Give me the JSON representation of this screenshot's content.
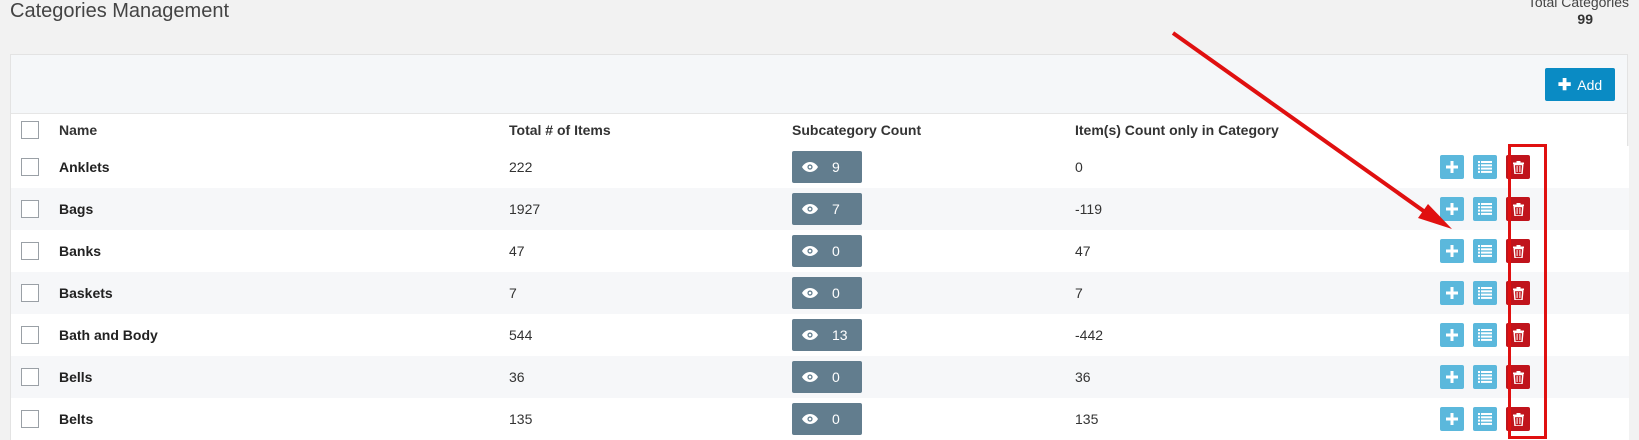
{
  "page": {
    "title": "Categories Management",
    "total_label": "Total Categories",
    "total_value": "99"
  },
  "toolbar": {
    "add_label": "Add",
    "add_icon": "plus-icon"
  },
  "table": {
    "columns": [
      "Name",
      "Total # of Items",
      "Subcategory Count",
      "Item(s) Count only in Category"
    ],
    "rows": [
      {
        "name": "Anklets",
        "total": "222",
        "sub": "9",
        "only": "0"
      },
      {
        "name": "Bags",
        "total": "1927",
        "sub": "7",
        "only": "-119"
      },
      {
        "name": "Banks",
        "total": "47",
        "sub": "0",
        "only": "47"
      },
      {
        "name": "Baskets",
        "total": "7",
        "sub": "0",
        "only": "7"
      },
      {
        "name": "Bath and Body",
        "total": "544",
        "sub": "13",
        "only": "-442"
      },
      {
        "name": "Bells",
        "total": "36",
        "sub": "0",
        "only": "36"
      },
      {
        "name": "Belts",
        "total": "135",
        "sub": "0",
        "only": "135"
      }
    ]
  },
  "colors": {
    "add_button": "#0a8bc4",
    "subcategory_button": "#627d8e",
    "action_light_blue": "#5bb8dc",
    "action_delete_red": "#c0141c",
    "annotation_red": "#e01010"
  },
  "icons": {
    "subcategory": "eye-icon",
    "row_add": "plus-icon",
    "row_list": "list-icon",
    "row_delete": "trash-icon"
  }
}
